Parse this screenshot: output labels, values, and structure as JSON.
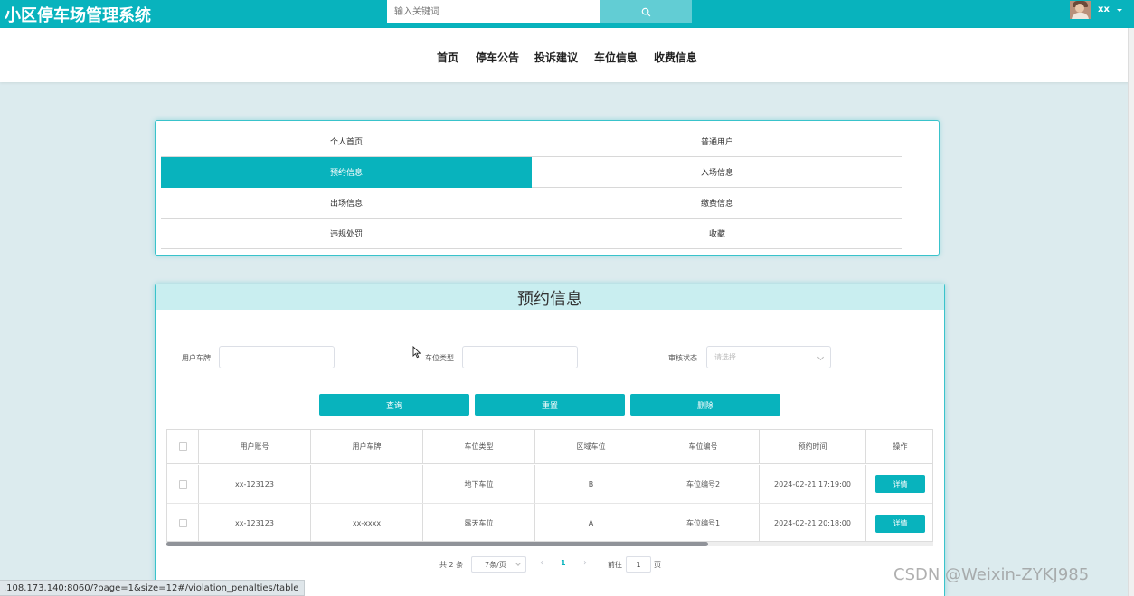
{
  "header": {
    "brand": "小区停车场管理系统",
    "search_placeholder": "输入关键词",
    "user_name": "xx"
  },
  "nav": [
    "首页",
    "停车公告",
    "投诉建议",
    "车位信息",
    "收费信息"
  ],
  "menu": [
    {
      "label": "个人首页",
      "active": false
    },
    {
      "label": "普通用户",
      "active": false
    },
    {
      "label": "预约信息",
      "active": true
    },
    {
      "label": "入场信息",
      "active": false
    },
    {
      "label": "出场信息",
      "active": false
    },
    {
      "label": "缴费信息",
      "active": false
    },
    {
      "label": "违规处罚",
      "active": false
    },
    {
      "label": "收藏",
      "active": false
    }
  ],
  "panel": {
    "title": "预约信息",
    "filters": {
      "plate_label": "用户车牌",
      "type_label": "车位类型",
      "status_label": "审核状态",
      "status_placeholder": "请选择"
    },
    "buttons": {
      "query": "查询",
      "reset": "重置",
      "delete": "删除"
    },
    "table": {
      "columns": [
        "用户账号",
        "用户车牌",
        "车位类型",
        "区域车位",
        "车位编号",
        "预约时间",
        "操作"
      ],
      "rows": [
        {
          "account": "xx-123123",
          "plate": "",
          "type": "地下车位",
          "area": "B",
          "number": "车位编号2",
          "time": "2024-02-21 17:19:00",
          "action": "详情"
        },
        {
          "account": "xx-123123",
          "plate": "xx-xxxx",
          "type": "露天车位",
          "area": "A",
          "number": "车位编号1",
          "time": "2024-02-21 20:18:00",
          "action": "详情"
        }
      ]
    },
    "pagination": {
      "total": "共 2 条",
      "page_size": "7条/页",
      "current_page": "1",
      "goto_label": "前往",
      "goto_value": "1",
      "page_unit": "页"
    }
  },
  "status_url": ".108.173.140:8060/?page=1&size=12#/violation_penalties/table",
  "watermark": "CSDN @Weixin-ZYKJ985",
  "colors": {
    "accent": "#08b3bd",
    "background": "#dcebee"
  }
}
